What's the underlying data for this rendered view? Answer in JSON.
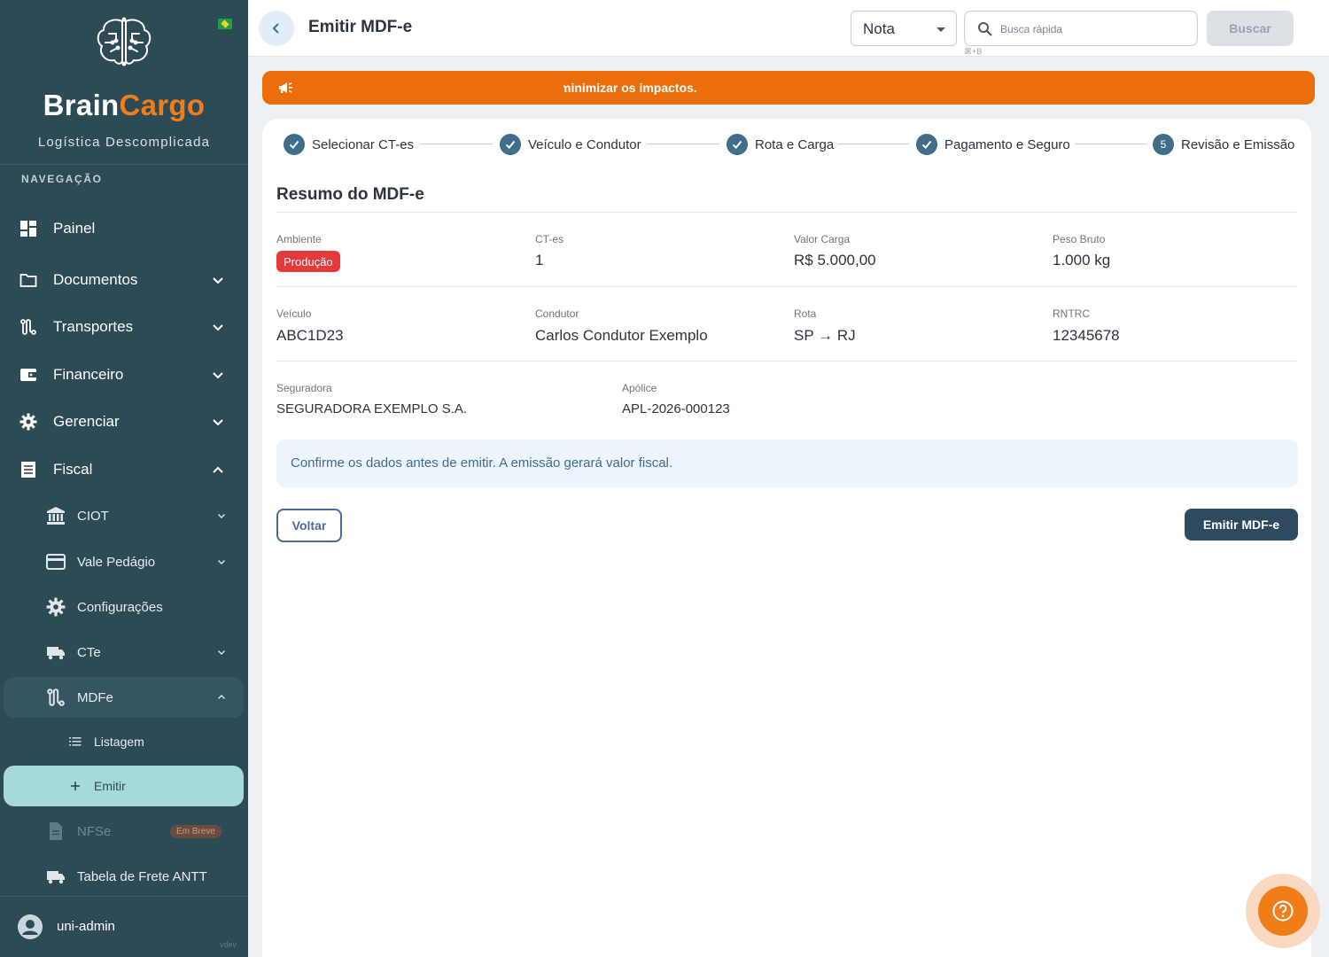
{
  "sidebar": {
    "brand_part1": "Brain",
    "brand_part2": "Cargo",
    "tagline": "Logística Descomplicada",
    "nav_heading": "NAVEGAÇÃO",
    "items": [
      {
        "label": "Painel",
        "icon": "dashboard-icon"
      },
      {
        "label": "Documentos",
        "icon": "folder-icon"
      },
      {
        "label": "Transportes",
        "icon": "route-icon"
      },
      {
        "label": "Financeiro",
        "icon": "wallet-icon"
      },
      {
        "label": "Gerenciar",
        "icon": "gear-icon"
      },
      {
        "label": "Fiscal",
        "icon": "receipt-icon"
      }
    ],
    "fiscal_sub": [
      {
        "label": "CIOT",
        "icon": "bank-icon"
      },
      {
        "label": "Vale Pedágio",
        "icon": "card-icon"
      },
      {
        "label": "Configurações",
        "icon": "gear-icon"
      },
      {
        "label": "CTe",
        "icon": "truck-icon"
      },
      {
        "label": "MDFe",
        "icon": "route-icon"
      },
      {
        "label": "NFSe",
        "icon": "document-icon",
        "badge": "Em Breve"
      },
      {
        "label": "Tabela de Frete ANTT",
        "icon": "truck-icon"
      }
    ],
    "mdfe_sub": [
      {
        "label": "Listagem",
        "icon": "list-icon"
      },
      {
        "label": "Emitir",
        "icon": "plus-icon"
      }
    ],
    "user": "uni-admin",
    "version": "vdev"
  },
  "topbar": {
    "title": "Emitir MDF-e",
    "select_value": "Nota",
    "search_placeholder": "Busca rápida",
    "shortcut": "⌘+B",
    "search_button": "Buscar"
  },
  "announcement": {
    "text": "minimizar os impactos."
  },
  "stepper": {
    "steps": [
      {
        "label": "Selecionar CT-es",
        "status": "done"
      },
      {
        "label": "Veículo e Condutor",
        "status": "done"
      },
      {
        "label": "Rota e Carga",
        "status": "done"
      },
      {
        "label": "Pagamento e Seguro",
        "status": "done"
      },
      {
        "label": "Revisão e Emissão",
        "status": "current",
        "number": "5"
      }
    ]
  },
  "summary": {
    "title": "Resumo do MDF-e",
    "ambiente_label": "Ambiente",
    "ambiente_value": "Produção",
    "ctes_label": "CT-es",
    "ctes_value": "1",
    "valor_label": "Valor Carga",
    "valor_value": "R$ 5.000,00",
    "peso_label": "Peso Bruto",
    "peso_value": "1.000 kg",
    "veiculo_label": "Veículo",
    "veiculo_value": "ABC1D23",
    "condutor_label": "Condutor",
    "condutor_value": "Carlos Condutor Exemplo",
    "rota_label": "Rota",
    "rota_value": "SP → RJ",
    "rntrc_label": "RNTRC",
    "rntrc_value": "12345678",
    "seguradora_label": "Seguradora",
    "seguradora_value": "SEGURADORA EXEMPLO S.A.",
    "apolice_label": "Apólice",
    "apolice_value": "APL-2026-000123"
  },
  "info_message": "Confirme os dados antes de emitir. A emissão gerará valor fiscal.",
  "actions": {
    "back": "Voltar",
    "emit": "Emitir MDF-e"
  },
  "colors": {
    "sidebar_bg": "#2d4a57",
    "brand_accent": "#f07d1a",
    "announcement": "#ec6d0c",
    "step_dot": "#3f6d8a",
    "env_badge": "#e5393a",
    "emit_button": "#2f4a5e",
    "selected_nav": "#a6d9da"
  }
}
